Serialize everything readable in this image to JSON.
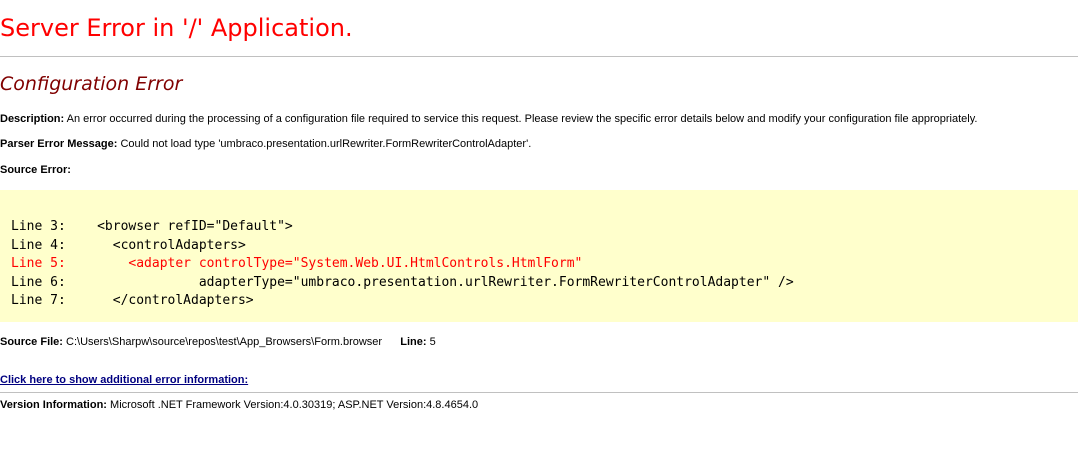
{
  "title": "Server Error in '/' Application.",
  "subtitle": "Configuration Error",
  "description": {
    "label": "Description:",
    "text": "An error occurred during the processing of a configuration file required to service this request. Please review the specific error details below and modify your configuration file appropriately."
  },
  "parser_error": {
    "label": "Parser Error Message:",
    "text": "Could not load type 'umbraco.presentation.urlRewriter.FormRewriterControlAdapter'."
  },
  "source_error": {
    "label": "Source Error:",
    "lines": [
      "Line 3:    <browser refID=\"Default\">",
      "Line 4:      <controlAdapters>",
      "Line 5:        <adapter controlType=\"System.Web.UI.HtmlControls.HtmlForm\"",
      "Line 6:                 adapterType=\"umbraco.presentation.urlRewriter.FormRewriterControlAdapter\" />",
      "Line 7:      </controlAdapters>"
    ],
    "highlighted_line_index": 2
  },
  "source_file": {
    "label": "Source File:",
    "path": "C:\\Users\\Sharpw\\source\\repos\\test\\App_Browsers\\Form.browser",
    "line_label": "Line:",
    "line_number": "5"
  },
  "more_info_link": "Click here to show additional error information:",
  "version_info": {
    "label": "Version Information:",
    "text": "Microsoft .NET Framework Version:4.0.30319; ASP.NET Version:4.8.4654.0"
  },
  "colors": {
    "title": "#ff0000",
    "subtitle": "#800000",
    "code_background": "#ffffcc",
    "error_line": "#ff0000",
    "link": "#000080",
    "rule": "#c0c0c0"
  }
}
